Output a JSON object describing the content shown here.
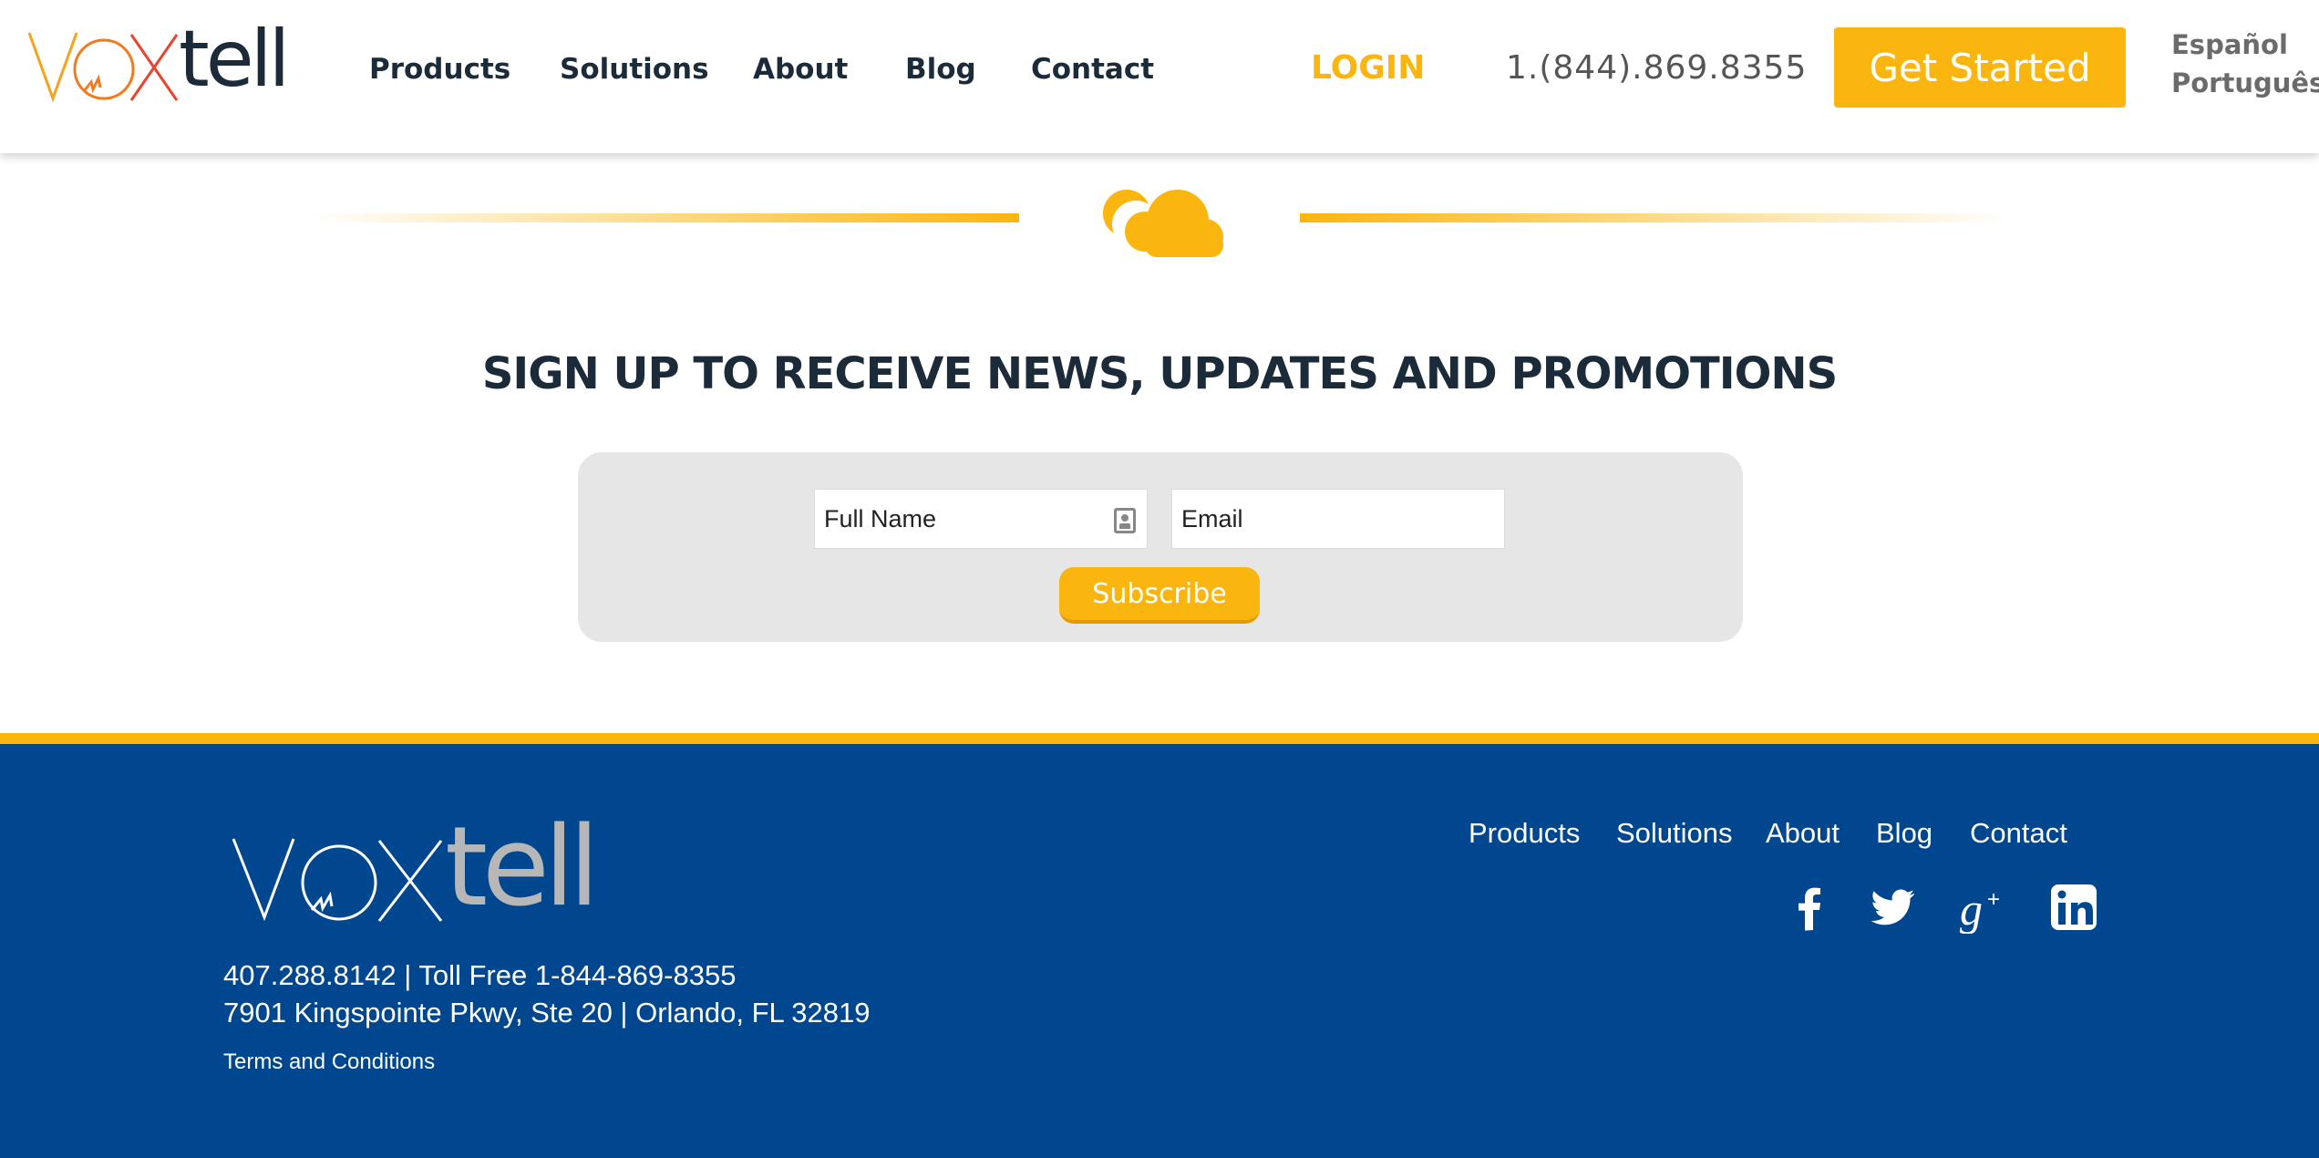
{
  "header": {
    "logo_text": "voxtell",
    "nav": [
      "Products",
      "Solutions",
      "About",
      "Blog",
      "Contact"
    ],
    "login": "LOGIN",
    "phone": "1.(844).869.8355",
    "cta": "Get Started",
    "languages": [
      "Español",
      "Português"
    ]
  },
  "signup": {
    "title": "SIGN UP TO RECEIVE NEWS, UPDATES AND PROMOTIONS",
    "name_placeholder": "Full Name",
    "email_placeholder": "Email",
    "button": "Subscribe"
  },
  "footer": {
    "logo_text": "voxtell",
    "phone_line": "407.288.8142 | Toll Free 1-844-869-8355",
    "address_line": "7901 Kingspointe Pkwy, Ste 20 | Orlando, FL 32819",
    "terms": "Terms and Conditions",
    "nav": [
      "Products",
      "Solutions",
      "About",
      "Blog",
      "Contact"
    ],
    "social": [
      "facebook-icon",
      "twitter-icon",
      "google-plus-icon",
      "linkedin-icon"
    ]
  },
  "colors": {
    "accent": "#fbb50f",
    "navy": "#00478f",
    "text_dark": "#1c2b39",
    "form_bg": "#e6e6e6",
    "logo_gray": "#b7b7b7"
  }
}
